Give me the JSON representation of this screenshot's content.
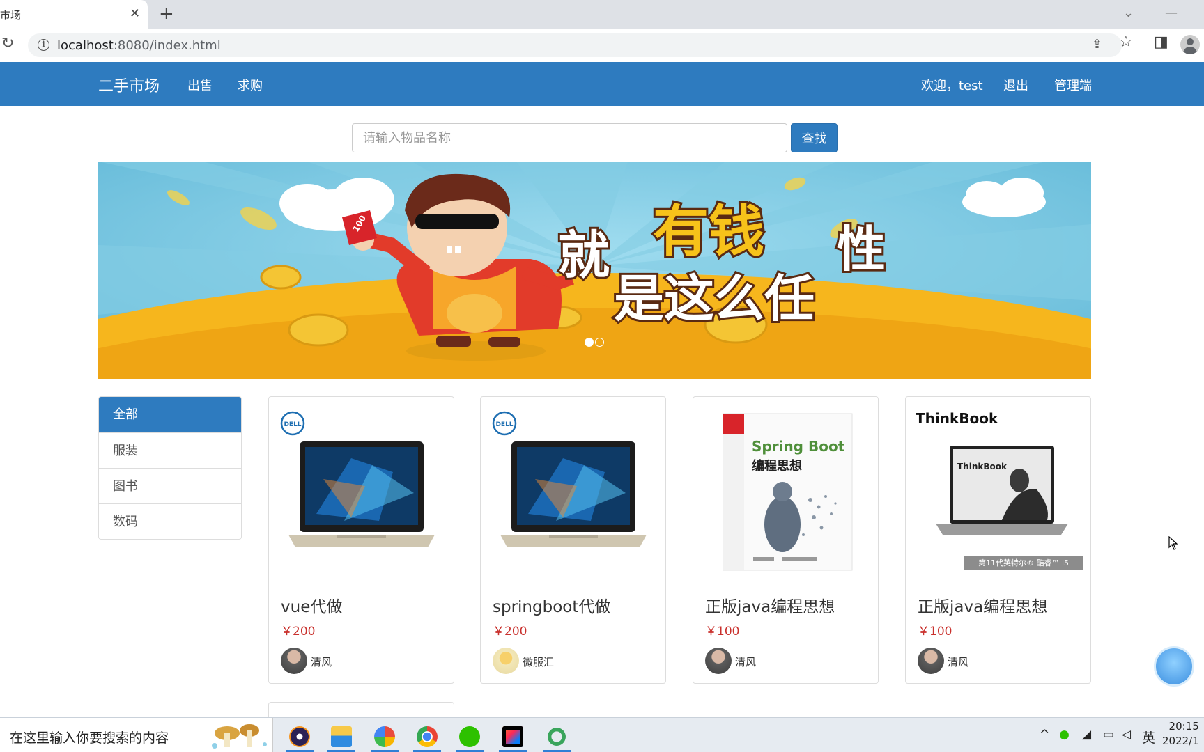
{
  "browser": {
    "tab_title": "市场",
    "tab_close": "✕",
    "new_tab": "+",
    "url_host": "localhost",
    "url_rest": ":8080/index.html"
  },
  "navbar": {
    "brand": "二手市场",
    "links": [
      "出售",
      "求购"
    ],
    "welcome": "欢迎，test",
    "logout": "退出",
    "admin": "管理端"
  },
  "search": {
    "placeholder": "请输入物品名称",
    "button": "查找"
  },
  "banner": {
    "headline_top": "有钱",
    "headline_left": "就",
    "headline_right": "性",
    "headline_bottom": "是这么任",
    "ticket_text": "100",
    "slide_count": 2,
    "active_slide": 1
  },
  "categories": [
    {
      "label": "全部",
      "active": true
    },
    {
      "label": "服装",
      "active": false
    },
    {
      "label": "图书",
      "active": false
    },
    {
      "label": "数码",
      "active": false
    }
  ],
  "products": [
    {
      "title": "vue代做",
      "price": "￥200",
      "seller": "清风",
      "brand_logo": "DELL",
      "image": "dell-laptop"
    },
    {
      "title": "springboot代做",
      "price": "￥200",
      "seller": "微服汇",
      "brand_logo": "DELL",
      "image": "dell-laptop"
    },
    {
      "title": "正版java编程思想",
      "price": "￥100",
      "seller": "清风",
      "book_title": "Spring Boot",
      "book_subtitle": "编程思想",
      "image": "book"
    },
    {
      "title": "正版java编程思想",
      "price": "￥100",
      "seller": "清风",
      "brand_logo": "ThinkBook",
      "screen_text": "ThinkBook",
      "badge": "第11代英特尔® 酷睿™ i5",
      "image": "thinkbook-laptop"
    }
  ],
  "taskbar": {
    "search_text": "在这里输入你要搜索的内容",
    "ime": "英",
    "time": "20:15",
    "date": "2022/1"
  },
  "colors": {
    "primary": "#2e7bbf",
    "price": "#c9302c"
  }
}
